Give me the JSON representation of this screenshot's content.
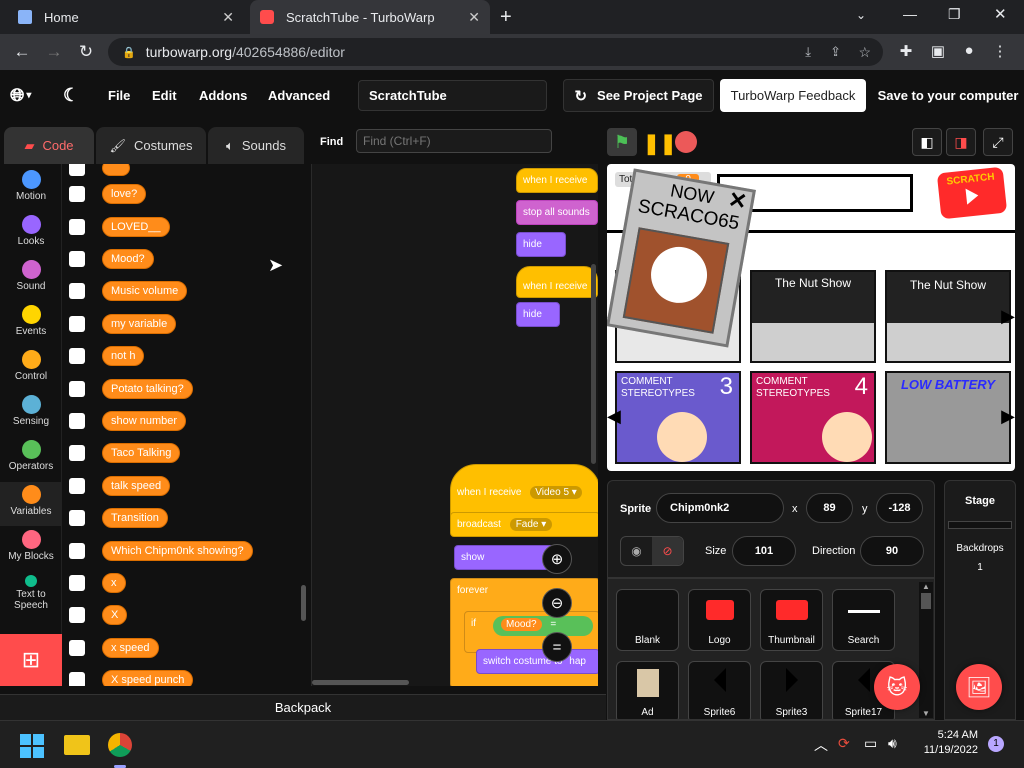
{
  "browser": {
    "tabs": [
      {
        "label": "Home",
        "active": false
      },
      {
        "label": "ScratchTube - TurboWarp",
        "active": true
      }
    ],
    "url_host": "turbowarp.org",
    "url_path": "/402654886/editor"
  },
  "menu": {
    "file": "File",
    "edit": "Edit",
    "addons": "Addons",
    "advanced": "Advanced",
    "project_title": "ScratchTube",
    "see_project_page": "See Project Page",
    "feedback": "TurboWarp Feedback",
    "save": "Save to your computer"
  },
  "editor_tabs": {
    "code": "Code",
    "costumes": "Costumes",
    "sounds": "Sounds"
  },
  "find": {
    "label": "Find",
    "placeholder": "Find (Ctrl+F)"
  },
  "categories": [
    {
      "label": "Motion",
      "color": "#4c97ff"
    },
    {
      "label": "Looks",
      "color": "#9966ff"
    },
    {
      "label": "Sound",
      "color": "#cf63cf"
    },
    {
      "label": "Events",
      "color": "#ffd500"
    },
    {
      "label": "Control",
      "color": "#ffab19"
    },
    {
      "label": "Sensing",
      "color": "#5cb1d6"
    },
    {
      "label": "Operators",
      "color": "#59c059"
    },
    {
      "label": "Variables",
      "color": "#ff8c1a"
    },
    {
      "label": "My Blocks",
      "color": "#ff6680"
    },
    {
      "label": "Text to Speech",
      "color": "#0fbd8c"
    }
  ],
  "variables": [
    "love?",
    "LOVED__",
    "Mood?",
    "Music volume",
    "my variable",
    "not h",
    "Potato talking?",
    "show number",
    "Taco Talking",
    "talk speed",
    "Transition",
    "Which Chipm0nk showing?",
    "x",
    "X",
    "x speed",
    "X speed punch"
  ],
  "workspace_blocks": {
    "when_receive": "when I receive",
    "stop_all_sounds": "stop all sounds",
    "hide": "hide",
    "when_receive_2": "when I receive",
    "hide_2": "hide",
    "when_receive_video": "when I receive",
    "video_value": "Video 5 ▾",
    "broadcast": "broadcast",
    "fade_value": "Fade ▾",
    "show": "show",
    "forever": "forever",
    "if": "if",
    "mood": "Mood?",
    "equals": "=",
    "switch_costume": "switch costume to",
    "happy": "hap"
  },
  "backpack": "Backpack",
  "stage": {
    "total_views_label": "Total Views",
    "total_views_value": "0",
    "popup_line1": "NOW",
    "popup_line2": "SCRACO65",
    "logo_text": "SCRATCH",
    "thumb_titles": [
      "The Nut Show",
      "The Nut Show"
    ],
    "comment_title": "COMMENT STEREOTYPES",
    "comment_nums": [
      "3",
      "4"
    ],
    "low_battery": "LOW BATTERY"
  },
  "sprite_info": {
    "sprite_label": "Sprite",
    "sprite_name": "Chipm0nk2",
    "x_label": "x",
    "x_value": "89",
    "y_label": "y",
    "y_value": "-128",
    "size_label": "Size",
    "size_value": "101",
    "direction_label": "Direction",
    "direction_value": "90"
  },
  "sprites": [
    "Blank",
    "Logo",
    "Thumbnail",
    "Search",
    "Ad",
    "Sprite6",
    "Sprite3",
    "Sprite17"
  ],
  "stage_panel": {
    "title": "Stage",
    "backdrops_label": "Backdrops",
    "backdrops_count": "1"
  },
  "taskbar": {
    "time": "5:24 AM",
    "date": "11/19/2022",
    "notifications": "1"
  }
}
